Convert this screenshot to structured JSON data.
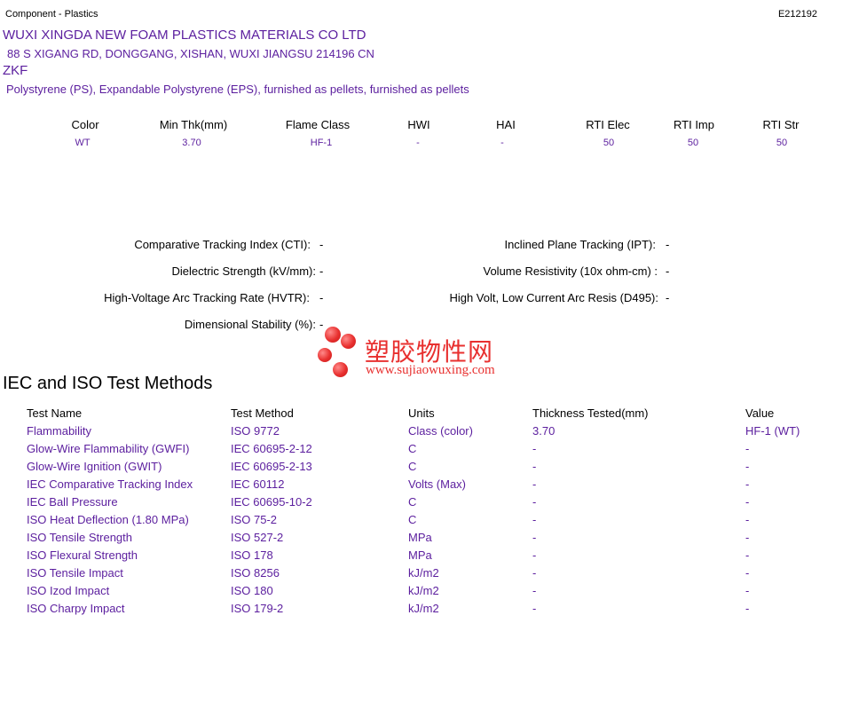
{
  "header": {
    "left": "Component - Plastics",
    "right": "E212192"
  },
  "company": {
    "name": "WUXI XINGDA NEW FOAM PLASTICS MATERIALS CO LTD",
    "address": "88 S XIGANG RD, DONGGANG, XISHAN, WUXI  JIANGSU  214196 CN",
    "product": "ZKF",
    "description": "Polystyrene (PS), Expandable Polystyrene (EPS), furnished as pellets, furnished as pellets"
  },
  "ratings": {
    "headers": [
      "Color",
      "Min Thk(mm)",
      "Flame Class",
      "HWI",
      "HAI",
      "RTI Elec",
      "RTI Imp",
      "RTI Str"
    ],
    "values": [
      "WT",
      "3.70",
      "HF-1",
      "-",
      "-",
      "50",
      "50",
      "50"
    ]
  },
  "properties": {
    "cti_label": "Comparative Tracking Index (CTI):",
    "cti_value": "-",
    "ipt_label": "Inclined Plane Tracking (IPT):",
    "ipt_value": "-",
    "dielectric_label": "Dielectric Strength (kV/mm):",
    "dielectric_value": "-",
    "resistivity_label": "Volume Resistivity (10x ohm-cm) :",
    "resistivity_value": "-",
    "hvtr_label": "High-Voltage Arc Tracking Rate (HVTR):",
    "hvtr_value": "-",
    "d495_label": "High Volt, Low Current Arc Resis (D495):",
    "d495_value": "-",
    "dimstab_label": "Dimensional Stability (%):",
    "dimstab_value": "-"
  },
  "watermark": {
    "cn": "塑胶物性网",
    "url": "www.sujiaowuxing.com"
  },
  "tests": {
    "title": "IEC and ISO Test Methods",
    "columns": [
      "Test Name",
      "Test Method",
      "Units",
      "Thickness Tested(mm)",
      "Value"
    ],
    "rows": [
      [
        "Flammability",
        "ISO 9772",
        "Class (color)",
        "3.70",
        "HF-1 (WT)"
      ],
      [
        "Glow-Wire Flammability (GWFI)",
        "IEC 60695-2-12",
        "C",
        "-",
        "-"
      ],
      [
        "Glow-Wire Ignition (GWIT)",
        "IEC 60695-2-13",
        "C",
        "-",
        "-"
      ],
      [
        "IEC Comparative Tracking Index",
        "IEC 60112",
        "Volts (Max)",
        "-",
        "-"
      ],
      [
        "IEC Ball Pressure",
        "IEC 60695-10-2",
        "C",
        "-",
        "-"
      ],
      [
        "ISO Heat Deflection (1.80 MPa)",
        "ISO 75-2",
        "C",
        "-",
        "-"
      ],
      [
        "ISO Tensile Strength",
        "ISO 527-2",
        "MPa",
        "-",
        "-"
      ],
      [
        "ISO Flexural Strength",
        "ISO 178",
        "MPa",
        "-",
        "-"
      ],
      [
        "ISO Tensile Impact",
        "ISO 8256",
        "kJ/m2",
        "-",
        "-"
      ],
      [
        "ISO Izod Impact",
        "ISO 180",
        "kJ/m2",
        "-",
        "-"
      ],
      [
        "ISO Charpy Impact",
        "ISO 179-2",
        "kJ/m2",
        "-",
        "-"
      ]
    ]
  },
  "colors": {
    "accent": "#5b1e9e",
    "watermark": "#e8302f"
  }
}
